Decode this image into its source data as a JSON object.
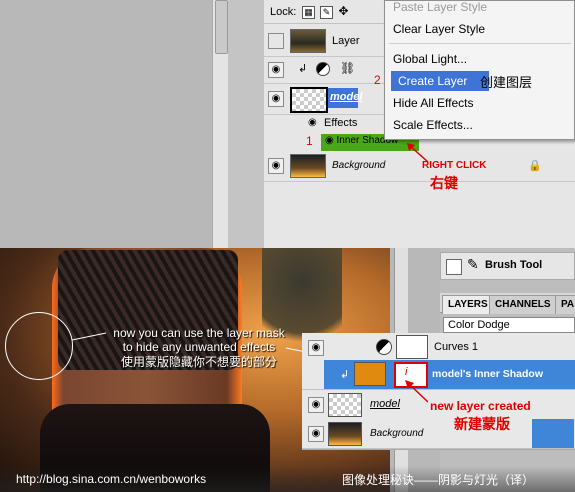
{
  "top_panel": {
    "lock_label": "Lock:",
    "layers": [
      {
        "name": "Layer"
      },
      {
        "name": "model"
      },
      {
        "effects_label": "Effects"
      },
      {
        "inner_shadow_label": "Inner Shadow"
      },
      {
        "name": "Background"
      }
    ]
  },
  "context_menu": {
    "items": [
      {
        "label": "Paste Layer Style",
        "disabled": true
      },
      {
        "label": "Clear Layer Style"
      },
      {
        "label": "Global Light..."
      },
      {
        "label": "Create Layer",
        "highlighted": true
      },
      {
        "label": "Hide All Effects"
      },
      {
        "label": "Scale Effects..."
      }
    ]
  },
  "annotations": {
    "step1": "1",
    "step2": "2",
    "create_layer_cn": "创建图层",
    "right_click": "RIGHT CLICK",
    "right_click_cn": "右键",
    "mask_note_line1": "now you can use the layer mask",
    "mask_note_line2": "to hide any unwanted effects",
    "mask_note_cn": "使用蒙版隐藏你不想要的部分",
    "new_layer_created": "new layer created",
    "new_layer_cn": "新建蒙版"
  },
  "bottom_panel": {
    "tool_label": "Brush Tool",
    "tabs": [
      "LAYERS",
      "CHANNELS",
      "PA"
    ],
    "blend_mode": "Color Dodge",
    "layers": [
      {
        "name": "Curves 1"
      },
      {
        "name": "model's Inner Shadow"
      },
      {
        "name": "model"
      },
      {
        "name": "Background"
      }
    ]
  },
  "footer": {
    "url": "http://blog.sina.com.cn/wenboworks",
    "title_cn": "图像处理秘诀——阴影与灯光（译）"
  },
  "colors": {
    "selection_blue": "#3d74d6",
    "effect_green": "#4aa818",
    "annotation_red": "#e00000"
  }
}
